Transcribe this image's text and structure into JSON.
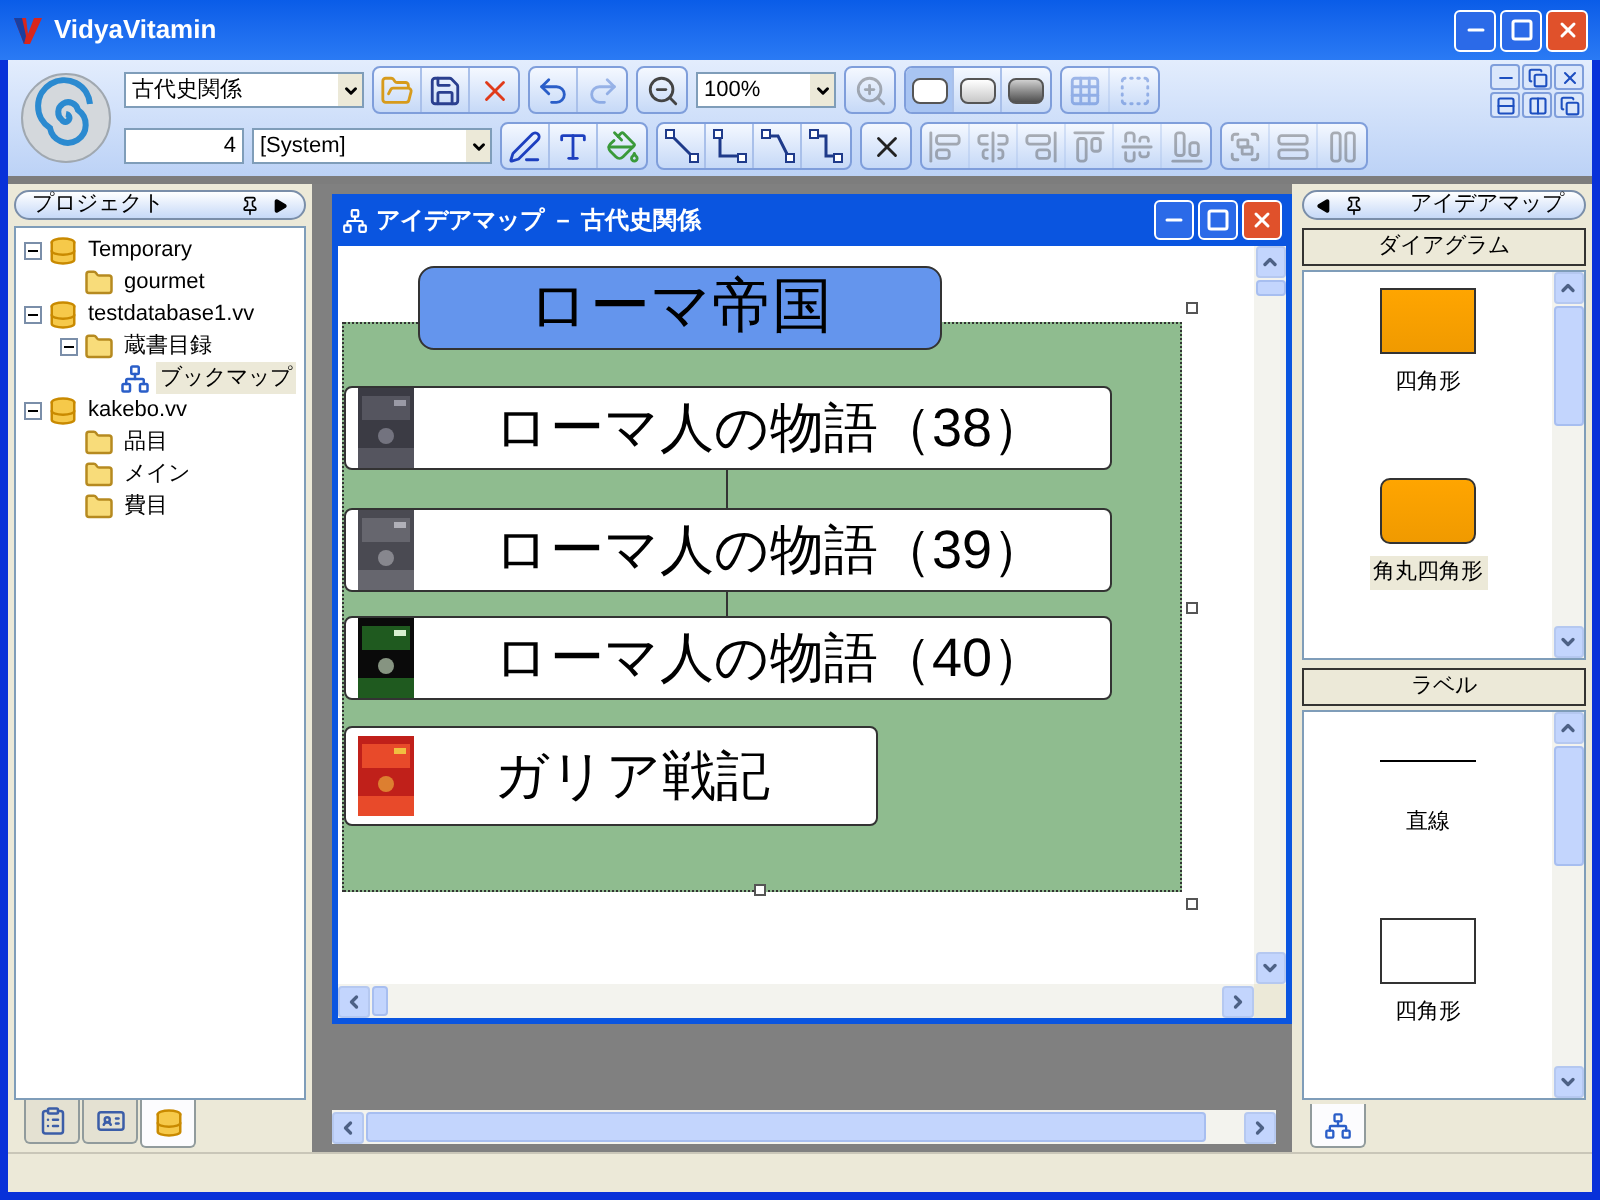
{
  "window": {
    "title": "VidyaVitamin"
  },
  "toolbar": {
    "row1": [
      {
        "kind": "combo",
        "value": "古代史関係"
      },
      {
        "kind": "group",
        "buttons": [
          {
            "kind": "open",
            "disabled": false
          },
          {
            "kind": "save",
            "disabled": false
          },
          {
            "kind": "delete",
            "disabled": false
          }
        ]
      },
      {
        "kind": "group",
        "buttons": [
          {
            "kind": "undo",
            "disabled": false
          },
          {
            "kind": "redo",
            "disabled": true
          }
        ]
      },
      {
        "kind": "group",
        "buttons": [
          {
            "kind": "zoom-out",
            "disabled": false
          }
        ]
      },
      {
        "kind": "zoom",
        "value": "100%"
      },
      {
        "kind": "group",
        "buttons": [
          {
            "kind": "zoom-in",
            "disabled": true
          }
        ]
      },
      {
        "kind": "group",
        "buttons": [
          {
            "kind": "shape-flat",
            "disabled": false,
            "selected": true
          },
          {
            "kind": "shape-soft",
            "disabled": false,
            "selected": false
          },
          {
            "kind": "shape-raised",
            "disabled": false,
            "selected": false
          }
        ]
      },
      {
        "kind": "group",
        "buttons": [
          {
            "kind": "grid",
            "disabled": true
          },
          {
            "kind": "shadow",
            "disabled": true
          }
        ]
      }
    ],
    "row2": [
      {
        "kind": "number",
        "value": "4"
      },
      {
        "kind": "font",
        "value": "[System]"
      },
      {
        "kind": "group",
        "buttons": [
          {
            "kind": "line-color",
            "disabled": false
          },
          {
            "kind": "font-color",
            "disabled": false
          },
          {
            "kind": "fill-color",
            "disabled": false
          }
        ]
      },
      {
        "kind": "group",
        "buttons": [
          {
            "kind": "connector-straight",
            "disabled": false
          },
          {
            "kind": "connector-elbow",
            "disabled": false
          },
          {
            "kind": "connector-diagonal",
            "disabled": false
          },
          {
            "kind": "connector-step",
            "disabled": false
          }
        ]
      },
      {
        "kind": "group",
        "buttons": [
          {
            "kind": "remove",
            "disabled": false
          }
        ]
      },
      {
        "kind": "group",
        "buttons": [
          {
            "kind": "align-left",
            "disabled": true
          },
          {
            "kind": "align-center",
            "disabled": true
          },
          {
            "kind": "align-right",
            "disabled": true
          },
          {
            "kind": "align-top",
            "disabled": true
          },
          {
            "kind": "align-middle",
            "disabled": true
          },
          {
            "kind": "align-bottom",
            "disabled": true
          }
        ]
      },
      {
        "kind": "group",
        "buttons": [
          {
            "kind": "group",
            "disabled": true
          },
          {
            "kind": "same-width",
            "disabled": true
          },
          {
            "kind": "same-height",
            "disabled": true
          }
        ]
      }
    ]
  },
  "project_panel": {
    "title": "プロジェクト",
    "tree": [
      {
        "label": "Temporary",
        "kind": "database",
        "expanded": true,
        "selected": false,
        "children": [
          {
            "label": "gourmet",
            "kind": "folder",
            "selected": false
          }
        ]
      },
      {
        "label": "testdatabase1.vv",
        "kind": "database",
        "expanded": true,
        "selected": false,
        "children": [
          {
            "label": "蔵書目録",
            "kind": "folder",
            "expanded": true,
            "selected": false,
            "children": [
              {
                "label": "ブックマップ",
                "kind": "map",
                "selected": true
              }
            ]
          }
        ]
      },
      {
        "label": "kakebo.vv",
        "kind": "database",
        "expanded": true,
        "selected": false,
        "children": [
          {
            "label": "品目",
            "kind": "folder",
            "selected": false
          },
          {
            "label": "メイン",
            "kind": "folder",
            "selected": false
          },
          {
            "label": "費目",
            "kind": "folder",
            "selected": false
          }
        ]
      }
    ],
    "tabs": [
      {
        "kind": "properties",
        "selected": false
      },
      {
        "kind": "form",
        "selected": false
      },
      {
        "kind": "database",
        "selected": true
      }
    ]
  },
  "document_window": {
    "title": "アイデアマップ － 古代史関係",
    "nodes": [
      {
        "kind": "group",
        "label": "ローマ帝国"
      },
      {
        "kind": "book",
        "label": "ローマ人の物語（38）"
      },
      {
        "kind": "book",
        "label": "ローマ人の物語（39）"
      },
      {
        "kind": "book",
        "label": "ローマ人の物語（40）"
      },
      {
        "kind": "book",
        "label": "ガリア戦記"
      }
    ]
  },
  "idea_panel": {
    "title": "アイデアマップ",
    "sections": [
      {
        "title": "ダイアグラム",
        "items": [
          {
            "label": "四角形",
            "kind": "rect",
            "selected": false
          },
          {
            "label": "角丸四角形",
            "kind": "rounded",
            "selected": true
          }
        ]
      },
      {
        "title": "ラベル",
        "items": [
          {
            "label": "直線",
            "kind": "line",
            "selected": false
          },
          {
            "label": "四角形",
            "kind": "box",
            "selected": false
          }
        ]
      }
    ]
  }
}
